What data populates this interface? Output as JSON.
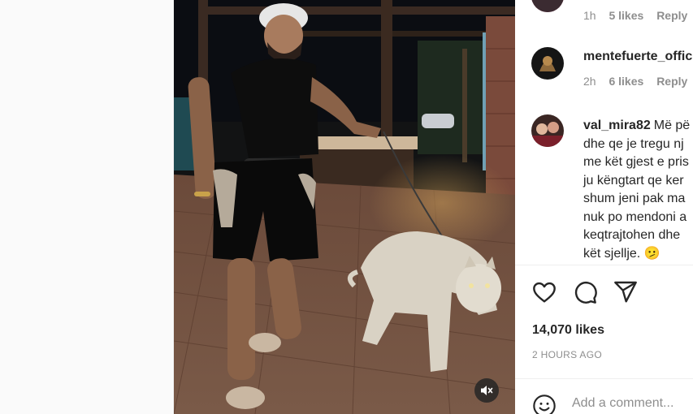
{
  "post": {
    "video": {
      "muted": true,
      "mute_icon": "speaker-muted-icon"
    },
    "comments": [
      {
        "username": "",
        "time": "1h",
        "likes": "5 likes",
        "reply": "Reply"
      },
      {
        "username": "mentefuerte_offic",
        "time": "2h",
        "likes": "6 likes",
        "reply": "Reply"
      },
      {
        "username": "val_mira82",
        "lines": [
          "Më pë",
          "dhe qe je tregu nj",
          "me kët gjest e pris",
          "ju këngtart qe ker",
          "shum jeni pak ma",
          "nuk po mendoni a",
          "keqtrajtohen dhe",
          "kët sjellje. 🫤"
        ]
      }
    ],
    "actions": {
      "like_icon": "heart-icon",
      "comment_icon": "comment-bubble-icon",
      "share_icon": "paper-plane-icon"
    },
    "likes_count": "14,070 likes",
    "timestamp": "2 HOURS AGO",
    "add_comment": {
      "placeholder": "Add a comment...",
      "emoji_icon": "smiley-icon"
    }
  }
}
